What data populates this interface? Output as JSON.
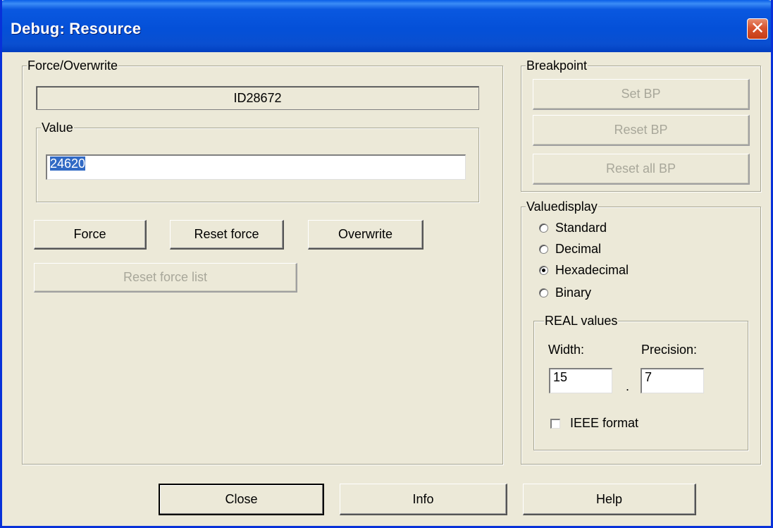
{
  "window": {
    "title": "Debug: Resource",
    "close_glyph": "✕"
  },
  "force_group": {
    "legend": "Force/Overwrite",
    "id_value": "ID28672",
    "value_group": {
      "legend": "Value",
      "input_value": "24620"
    },
    "buttons": {
      "force": "Force",
      "reset_force": "Reset force",
      "overwrite": "Overwrite",
      "reset_force_list": "Reset force list"
    }
  },
  "breakpoint_group": {
    "legend": "Breakpoint",
    "buttons": {
      "set_bp": "Set BP",
      "reset_bp": "Reset BP",
      "reset_all_bp": "Reset all BP"
    }
  },
  "valuedisplay_group": {
    "legend": "Valuedisplay",
    "options": [
      "Standard",
      "Decimal",
      "Hexadecimal",
      "Binary"
    ],
    "selected": "Hexadecimal",
    "real_values": {
      "legend": "REAL values",
      "width_label": "Width:",
      "precision_label": "Precision:",
      "width_value": "15",
      "separator": ".",
      "precision_value": "7",
      "ieee_label": "IEEE format",
      "ieee_checked": false
    }
  },
  "footer": {
    "close": "Close",
    "info": "Info",
    "help": "Help"
  },
  "colors": {
    "titlebar": "#0a52dc",
    "dialog_bg": "#ece9d8",
    "selection": "#316ac5",
    "close_button": "#d8542f"
  }
}
